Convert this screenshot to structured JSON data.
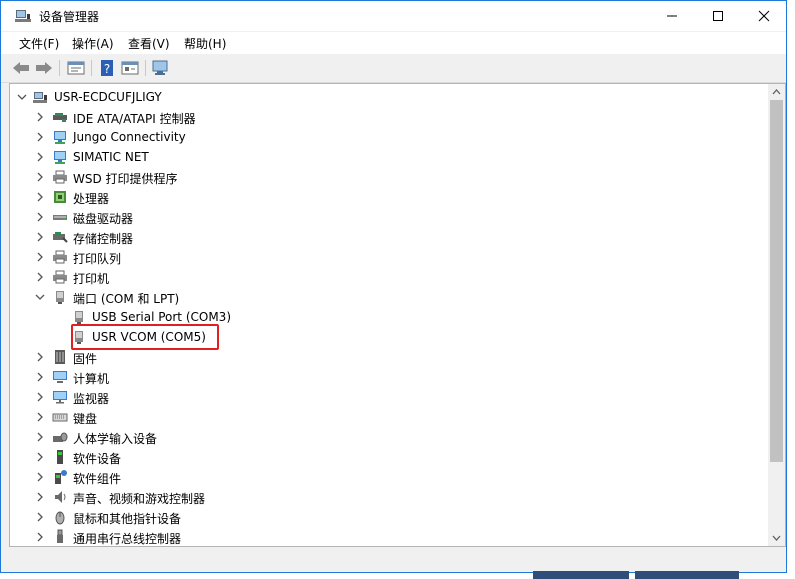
{
  "window": {
    "title": "设备管理器"
  },
  "menu": {
    "items": [
      {
        "label": "文件(F)"
      },
      {
        "label": "操作(A)"
      },
      {
        "label": "查看(V)"
      },
      {
        "label": "帮助(H)"
      }
    ]
  },
  "tree": {
    "root": "USR-ECDCUFJLIGY",
    "items": [
      {
        "label": "IDE ATA/ATAPI 控制器",
        "icon": "ide-controller-icon"
      },
      {
        "label": "Jungo Connectivity",
        "icon": "network-device-icon"
      },
      {
        "label": "SIMATIC NET",
        "icon": "network-device-icon"
      },
      {
        "label": "WSD 打印提供程序",
        "icon": "printer-icon"
      },
      {
        "label": "处理器",
        "icon": "processor-icon"
      },
      {
        "label": "磁盘驱动器",
        "icon": "disk-drive-icon"
      },
      {
        "label": "存储控制器",
        "icon": "storage-controller-icon"
      },
      {
        "label": "打印队列",
        "icon": "printer-icon"
      },
      {
        "label": "打印机",
        "icon": "printer-icon"
      },
      {
        "label": "端口 (COM 和 LPT)",
        "icon": "port-icon",
        "expanded": true
      },
      {
        "label": "USB Serial Port (COM3)",
        "icon": "port-icon",
        "child": true
      },
      {
        "label": "USR VCOM (COM5)",
        "icon": "port-icon",
        "child": true,
        "highlighted": true
      },
      {
        "label": "固件",
        "icon": "firmware-icon"
      },
      {
        "label": "计算机",
        "icon": "computer-icon"
      },
      {
        "label": "监视器",
        "icon": "monitor-icon"
      },
      {
        "label": "键盘",
        "icon": "keyboard-icon"
      },
      {
        "label": "人体学输入设备",
        "icon": "hid-icon"
      },
      {
        "label": "软件设备",
        "icon": "software-device-icon"
      },
      {
        "label": "软件组件",
        "icon": "software-component-icon"
      },
      {
        "label": "声音、视频和游戏控制器",
        "icon": "audio-icon"
      },
      {
        "label": "鼠标和其他指针设备",
        "icon": "mouse-icon"
      },
      {
        "label": "通用串行总线控制器",
        "icon": "usb-icon"
      }
    ]
  },
  "colors": {
    "accent": "#0078d7",
    "highlight_box": "#e02020",
    "selection": "#cce8ff"
  }
}
